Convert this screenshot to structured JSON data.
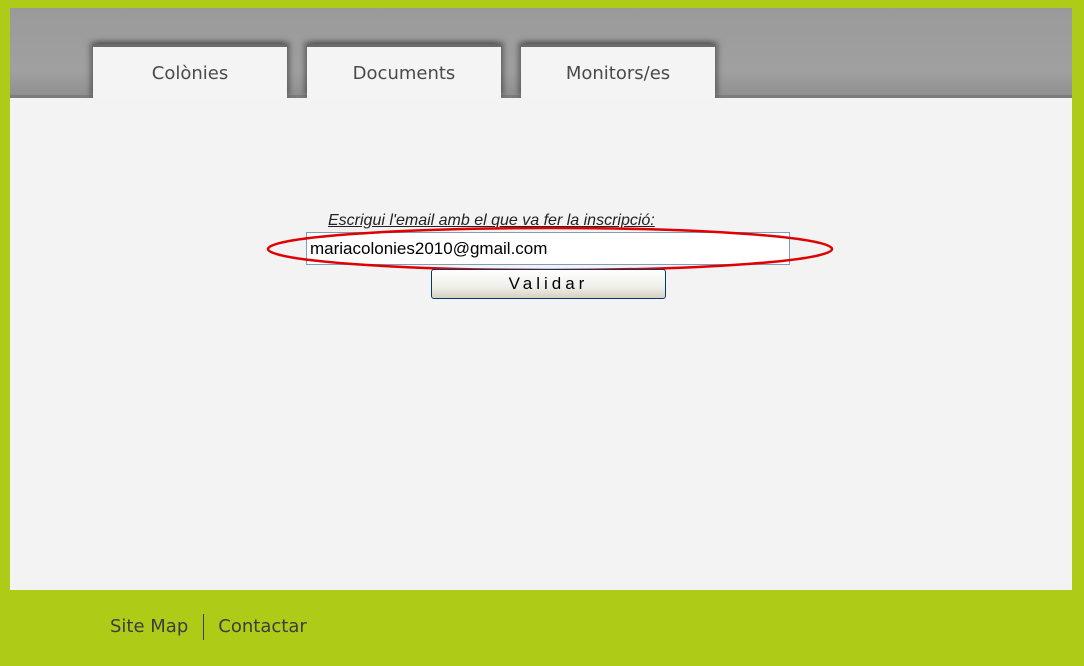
{
  "nav": {
    "tabs": [
      {
        "label": "Colònies"
      },
      {
        "label": "Documents"
      },
      {
        "label": "Monitors/es"
      }
    ]
  },
  "form": {
    "prompt": "Escrigui l'email amb el que va fer la inscripció:",
    "email_value": "mariacolonies2010@gmail.com",
    "submit_label": "Validar"
  },
  "annotation": {
    "highlight_color": "#e00000"
  },
  "footer": {
    "links": [
      {
        "label": "Site Map"
      },
      {
        "label": "Contactar"
      }
    ]
  },
  "colors": {
    "brand_green": "#aecb18",
    "header_gray": "#9a9a9a",
    "content_bg": "#f3f3f3"
  }
}
